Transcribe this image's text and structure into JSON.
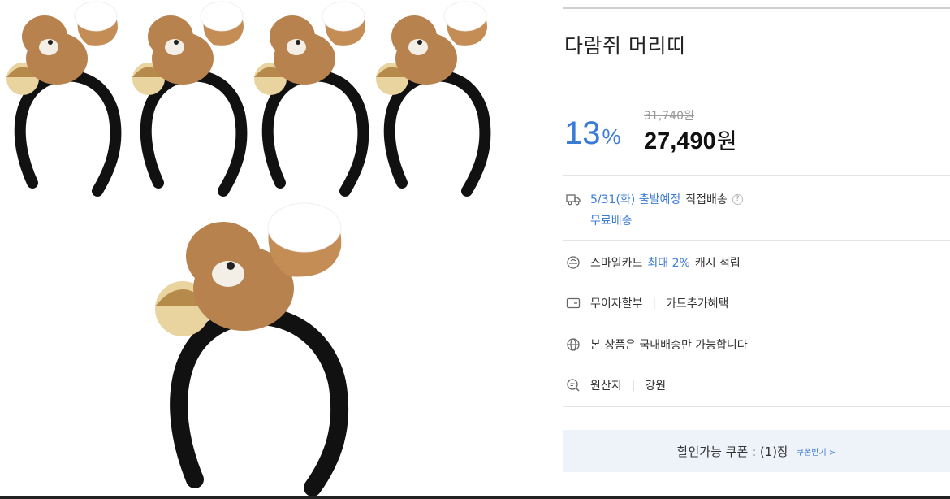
{
  "product": {
    "title": "다람쥐 머리띠",
    "discount_number": "13",
    "discount_unit": "%",
    "original_price": "31,740원",
    "sale_price": "27,490",
    "sale_currency": "원"
  },
  "shipping": {
    "date_text": "5/31(화) 출발예정",
    "method_text": "직접배송",
    "help_glyph": "?",
    "free_text": "무료배송"
  },
  "smile_card": {
    "prefix": "스마일카드",
    "highlight": "최대 2%",
    "suffix": "캐시 적립"
  },
  "installment": {
    "label": "무이자할부",
    "separator": "|",
    "benefit": "카드추가혜택"
  },
  "domestic": {
    "text": "본 상품은 국내배송만 가능합니다"
  },
  "origin": {
    "label": "원산지",
    "separator": "|",
    "value": "강원"
  },
  "coupon": {
    "text": "할인가능 쿠폰 : (1)장",
    "link": "쿠폰받기 >"
  },
  "icons": {
    "truck": "truck-icon",
    "card_smile": "smile-card-icon",
    "card": "card-icon",
    "globe": "globe-icon",
    "origin": "search-origin-icon"
  },
  "colors": {
    "accent": "#3a7bd5",
    "coupon_bg": "#eef2f9"
  }
}
